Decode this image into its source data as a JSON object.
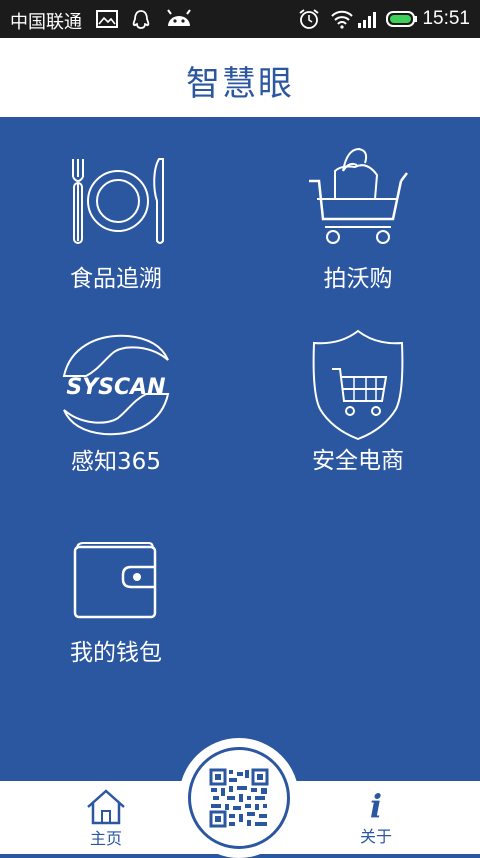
{
  "status_bar": {
    "carrier": "中国联通",
    "time": "15:51",
    "icons": [
      "image-icon",
      "qq-icon",
      "android-icon",
      "alarm-icon",
      "wifi-icon",
      "signal-icon",
      "battery-icon"
    ]
  },
  "header": {
    "title": "智慧眼"
  },
  "tiles": [
    {
      "label": "食品追溯",
      "icon": "fork-plate-knife-icon"
    },
    {
      "label": "拍沃购",
      "icon": "shopping-cart-icon"
    },
    {
      "label": "感知365",
      "icon": "syscan-logo-icon",
      "logo_text": "SYSCAN"
    },
    {
      "label": "安全电商",
      "icon": "shield-cart-icon"
    },
    {
      "label": "我的钱包",
      "icon": "wallet-icon"
    }
  ],
  "bottom_nav": {
    "home_label": "主页",
    "about_label": "关于",
    "scan_icon": "qr-code-icon"
  },
  "colors": {
    "primary": "#2b56a0",
    "status_bar": "#1b1b1b",
    "battery": "#3fd05a"
  }
}
